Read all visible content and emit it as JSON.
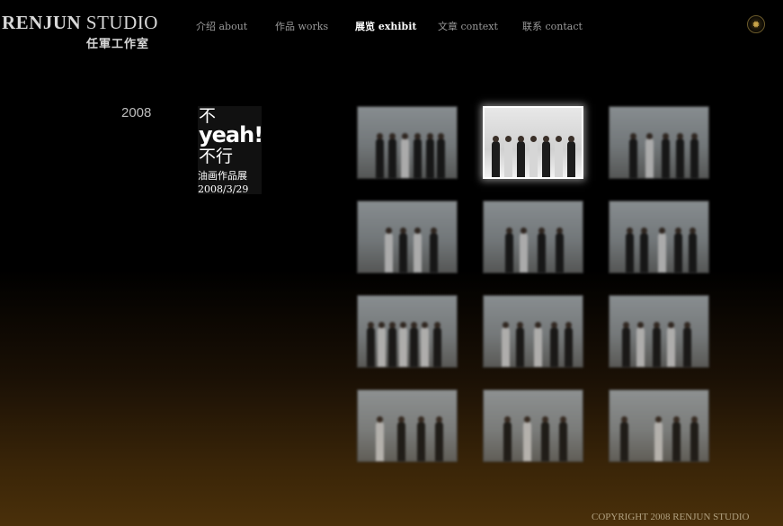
{
  "logo": {
    "en_bold": "RENJUN",
    "en_light": " STUDIO",
    "cn": "任軍工作室"
  },
  "nav": {
    "items": [
      {
        "label": "介绍  about",
        "active": false
      },
      {
        "label": "作品 works",
        "active": false
      },
      {
        "label": "展览  exhibit",
        "active": true
      },
      {
        "label": "文章  context",
        "active": false
      },
      {
        "label": "联系  contact",
        "active": false
      }
    ]
  },
  "corner_icon": {
    "icon": "sun-icon",
    "glyph": "✹"
  },
  "exhibit": {
    "year": "2008",
    "poster": {
      "line1": "不",
      "line2": "yeah!",
      "line3": "不行",
      "line4": "油画作品展",
      "line5": "2008/3/29"
    },
    "thumbnails": [
      {
        "selected": false
      },
      {
        "selected": true
      },
      {
        "selected": false
      },
      {
        "selected": false
      },
      {
        "selected": false
      },
      {
        "selected": false
      },
      {
        "selected": false
      },
      {
        "selected": false
      },
      {
        "selected": false
      },
      {
        "selected": false
      },
      {
        "selected": false
      },
      {
        "selected": false
      }
    ]
  },
  "footer": {
    "copyright": "COPYRIGHT 2008 RENJUN STUDIO"
  },
  "colors": {
    "nav_active": "#ffffff",
    "nav_inactive": "#9a9a9a",
    "footer_text": "#b0a080",
    "background_bottom": "#4a300a"
  }
}
